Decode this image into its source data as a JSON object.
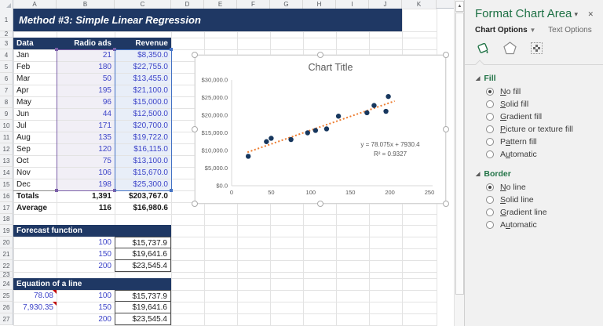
{
  "colors": {
    "navy": "#1F3864",
    "value_blue": "#3D44C8",
    "panel_green": "#217346",
    "trendline_orange": "#ED7D31",
    "point_navy": "#17375E",
    "range_b_border": "#7B5FA8",
    "range_c_border": "#4472C4"
  },
  "sheet": {
    "title": "Method #3: Simple Linear Regression",
    "col_headers": [
      "A",
      "B",
      "C",
      "D",
      "E",
      "F",
      "G",
      "H",
      "I",
      "J",
      "K"
    ],
    "row_count": 27,
    "table": {
      "headers": [
        "Data",
        "Radio ads",
        "Revenue"
      ],
      "rows": [
        {
          "month": "Jan",
          "ads": "21",
          "revenue": "$8,350.0"
        },
        {
          "month": "Feb",
          "ads": "180",
          "revenue": "$22,755.0"
        },
        {
          "month": "Mar",
          "ads": "50",
          "revenue": "$13,455.0"
        },
        {
          "month": "Apr",
          "ads": "195",
          "revenue": "$21,100.0"
        },
        {
          "month": "May",
          "ads": "96",
          "revenue": "$15,000.0"
        },
        {
          "month": "Jun",
          "ads": "44",
          "revenue": "$12,500.0"
        },
        {
          "month": "Jul",
          "ads": "171",
          "revenue": "$20,700.0"
        },
        {
          "month": "Aug",
          "ads": "135",
          "revenue": "$19,722.0"
        },
        {
          "month": "Sep",
          "ads": "120",
          "revenue": "$16,115.0"
        },
        {
          "month": "Oct",
          "ads": "75",
          "revenue": "$13,100.0"
        },
        {
          "month": "Nov",
          "ads": "106",
          "revenue": "$15,670.0"
        },
        {
          "month": "Dec",
          "ads": "198",
          "revenue": "$25,300.0"
        }
      ],
      "totals": {
        "label": "Totals",
        "ads": "1,391",
        "revenue": "$203,767.0"
      },
      "average": {
        "label": "Average",
        "ads": "116",
        "revenue": "$16,980.6"
      }
    },
    "forecast": {
      "header": "Forecast function",
      "rows": [
        {
          "x": "100",
          "y": "$15,737.9"
        },
        {
          "x": "150",
          "y": "$19,641.6"
        },
        {
          "x": "200",
          "y": "$23,545.4"
        }
      ]
    },
    "equation": {
      "header": "Equation of a line",
      "slope": "78.08",
      "intercept": "7,930.35",
      "rows": [
        {
          "x": "100",
          "y": "$15,737.9"
        },
        {
          "x": "150",
          "y": "$19,641.6"
        },
        {
          "x": "200",
          "y": "$23,545.4"
        }
      ]
    }
  },
  "chart_data": {
    "type": "scatter",
    "title": "Chart Title",
    "x": [
      21,
      180,
      50,
      195,
      96,
      44,
      171,
      135,
      120,
      75,
      106,
      198
    ],
    "y": [
      8350,
      22755,
      13455,
      21100,
      15000,
      12500,
      20700,
      19722,
      16115,
      13100,
      15670,
      25300
    ],
    "xlim": [
      0,
      250
    ],
    "ylim": [
      0,
      30000
    ],
    "x_ticks": [
      0,
      50,
      100,
      150,
      200,
      250
    ],
    "y_tick_labels": [
      "$0.0",
      "$5,000.0",
      "$10,000.0",
      "$15,000.0",
      "$20,000.0",
      "$25,000.0",
      "$30,000.0"
    ],
    "grid": false,
    "legend": "none",
    "trendline": {
      "slope": 78.075,
      "intercept": 7930.4,
      "x_start": 20,
      "x_end": 206,
      "equation_label": "y = 78.075x + 7930.4",
      "r2_label": "R² = 0.9327"
    }
  },
  "panel": {
    "title": "Format Chart Area",
    "menu_icon": "▾",
    "close_icon": "✕",
    "tabs": [
      {
        "label": "Chart Options"
      },
      {
        "label": "Text Options"
      }
    ],
    "icon_names": [
      "fill-line-bucket",
      "effects-pentagon",
      "size-properties"
    ],
    "sections": [
      {
        "header": "Fill",
        "options": [
          {
            "label": "No fill",
            "selected": true,
            "underline_index": 0
          },
          {
            "label": "Solid fill",
            "selected": false,
            "underline_index": 0
          },
          {
            "label": "Gradient fill",
            "selected": false,
            "underline_index": 0
          },
          {
            "label": "Picture or texture fill",
            "selected": false,
            "underline_index": 0
          },
          {
            "label": "Pattern fill",
            "selected": false,
            "underline_index": 1
          },
          {
            "label": "Automatic",
            "selected": false,
            "underline_index": 1
          }
        ]
      },
      {
        "header": "Border",
        "options": [
          {
            "label": "No line",
            "selected": true,
            "underline_index": 0
          },
          {
            "label": "Solid line",
            "selected": false,
            "underline_index": 0
          },
          {
            "label": "Gradient line",
            "selected": false,
            "underline_index": 0
          },
          {
            "label": "Automatic",
            "selected": false,
            "underline_index": 1
          }
        ]
      }
    ]
  }
}
